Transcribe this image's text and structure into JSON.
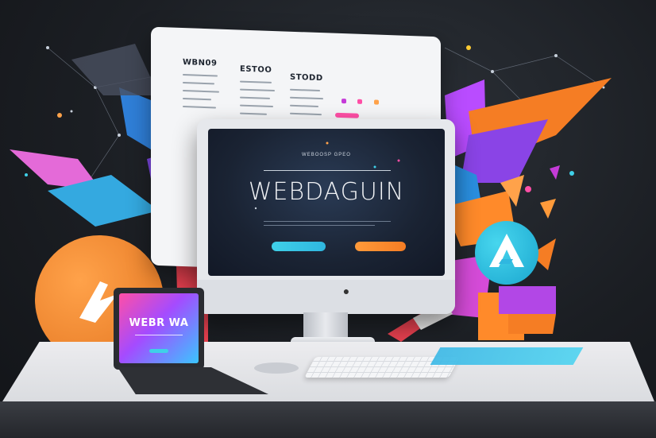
{
  "back_panel": {
    "columns": [
      {
        "title": "WBN09"
      },
      {
        "title": "ESTOO"
      },
      {
        "title": "STODD"
      }
    ]
  },
  "monitor": {
    "subtitle": "WEBOOSP GPEO",
    "title": "WEBDAGUIN",
    "logo": "apple-logo"
  },
  "laptop": {
    "title": "WEBR WA"
  },
  "colors": {
    "background": "#1b1e23",
    "accent_orange": "#f57d24",
    "accent_cyan": "#2fb7e0",
    "accent_purple": "#a44bff",
    "accent_pink": "#ff4fa6"
  }
}
